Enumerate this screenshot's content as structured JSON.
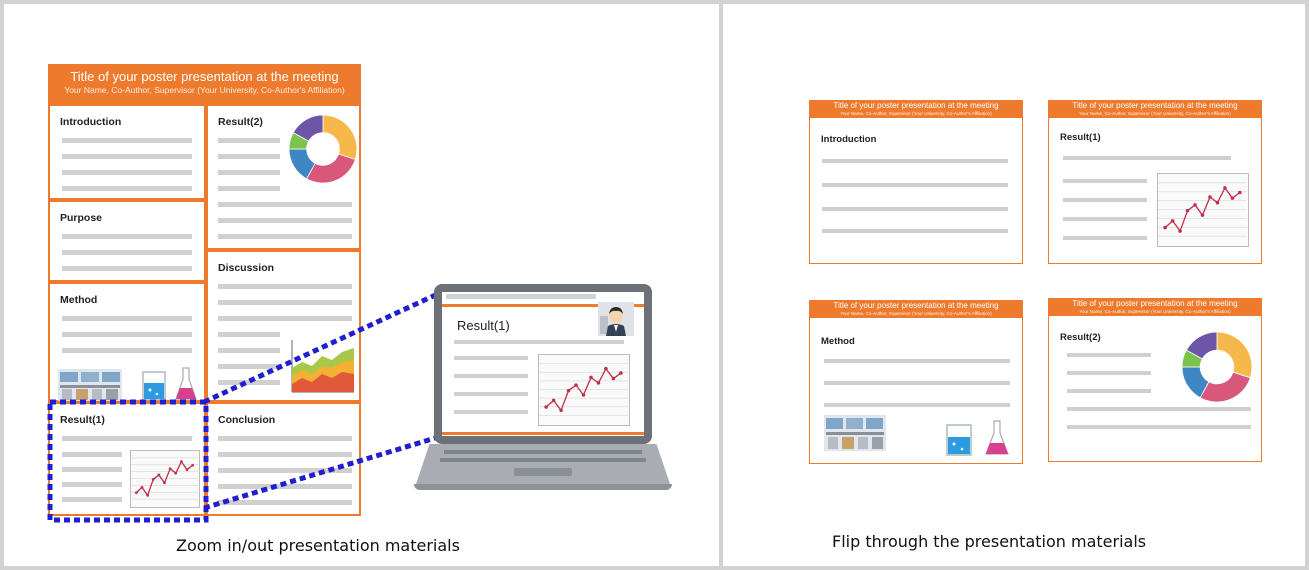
{
  "poster": {
    "title": "Title of your poster presentation at the meeting",
    "subtitle": "Your Name, Co-Author, Supervisor (Your University, Co-Author's Affiliation)",
    "sections": {
      "introduction": "Introduction",
      "purpose": "Purpose",
      "method": "Method",
      "result1": "Result(1)",
      "result2": "Result(2)",
      "discussion": "Discussion",
      "conclusion": "Conclusion"
    }
  },
  "laptop": {
    "slide_title": "Result(1)"
  },
  "slides": {
    "title": "Title of your poster presentation at the meeting",
    "subtitle": "Your Name, Co-Author, Supervisor (Your University, Co-Author's Affiliation)",
    "labels": [
      "Introduction",
      "Result(1)",
      "Method",
      "Result(2)"
    ]
  },
  "captions": {
    "left": "Zoom in/out presentation materials",
    "right": "Flip through the presentation materials"
  },
  "colors": {
    "accent": "#ee7b2d",
    "zoom_box": "#1f1fd1",
    "line_chart": "#c0304a",
    "donut": [
      "#f7b84b",
      "#d9577a",
      "#3f86c4",
      "#7bc44b",
      "#6d56a8"
    ]
  },
  "icons": {
    "presenter": "presenter-avatar-icon",
    "beaker": "beaker-icon",
    "flask": "flask-icon",
    "lab": "lab-photo-icon"
  }
}
